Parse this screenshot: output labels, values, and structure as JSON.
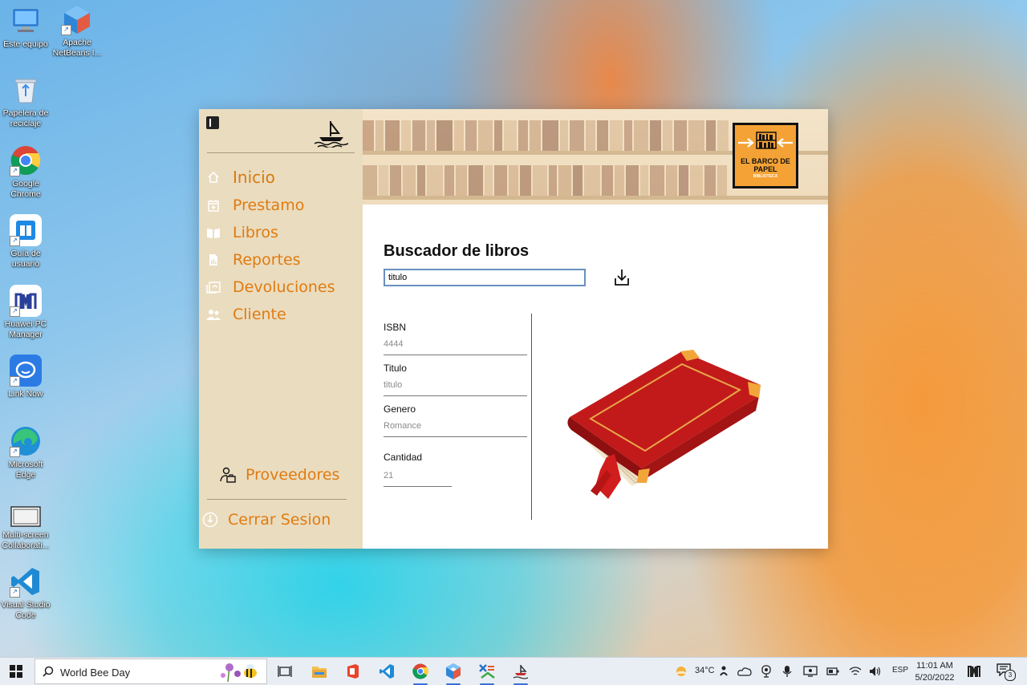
{
  "desktop": {
    "icons": [
      {
        "label": "Este equipo"
      },
      {
        "label": "Apache NetBeans I..."
      },
      {
        "label": "Papelera de reciclaje"
      },
      {
        "label": "Google Chrome"
      },
      {
        "label": "Guía de usuario"
      },
      {
        "label": "Huawei PC Manager"
      },
      {
        "label": "Link Now"
      },
      {
        "label": "Microsoft Edge"
      },
      {
        "label": "Multi-screen Collaborati..."
      },
      {
        "label": "Visual Studio Code"
      }
    ]
  },
  "sidebar": {
    "nav": [
      {
        "label": "Inicio",
        "icon": "home-icon"
      },
      {
        "label": "Prestamo",
        "icon": "calendar-icon"
      },
      {
        "label": "Libros",
        "icon": "book-open-icon"
      },
      {
        "label": "Reportes",
        "icon": "report-icon"
      },
      {
        "label": "Devoluciones",
        "icon": "returns-icon"
      },
      {
        "label": "Cliente",
        "icon": "users-icon"
      }
    ],
    "proveedores": "Proveedores",
    "logout": "Cerrar Sesion"
  },
  "banner": {
    "logo_line1": "EL BARCO DE",
    "logo_line2": "PAPEL",
    "logo_sub": "BIBLIOTECA"
  },
  "main": {
    "title": "Buscador de libros",
    "search_value": "titulo",
    "fields": [
      {
        "label": "ISBN",
        "value": "4444"
      },
      {
        "label": "Titulo",
        "value": "titulo"
      },
      {
        "label": "Genero",
        "value": "Romance"
      },
      {
        "label": "Cantidad",
        "value": "21"
      }
    ]
  },
  "taskbar": {
    "search_text": "World Bee Day",
    "weather": "34°C",
    "language": "ESP",
    "time": "11:01 AM",
    "date": "5/20/2022",
    "notification_count": "3"
  },
  "colors": {
    "accent": "#e07b10",
    "sidebar_bg": "#eadcbf",
    "logo_bg": "#f4a235"
  }
}
